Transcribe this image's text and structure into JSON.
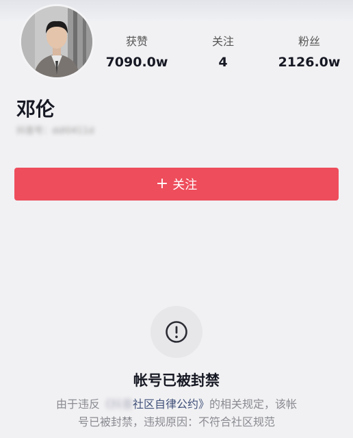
{
  "profile": {
    "nickname": "邓伦",
    "account_id": "抖音号：ddl0411d",
    "avatar_icon": "user-avatar-photo"
  },
  "stats": [
    {
      "label": "获赞",
      "value": "7090.0w"
    },
    {
      "label": "关注",
      "value": "4"
    },
    {
      "label": "粉丝",
      "value": "2126.0w"
    }
  ],
  "follow_button": {
    "icon": "+",
    "label": "关注",
    "color": "#ee4d5c"
  },
  "ban_notice": {
    "icon": "exclamation-circle-icon",
    "title": "帐号已被封禁",
    "desc_prefix": "由于违反",
    "desc_blurred": "《抖音",
    "desc_pact": "社区自律公约》",
    "desc_suffix_line1": "的相关规定，该帐",
    "desc_line2": "号已被封禁，违规原因：不符合社区规范"
  }
}
